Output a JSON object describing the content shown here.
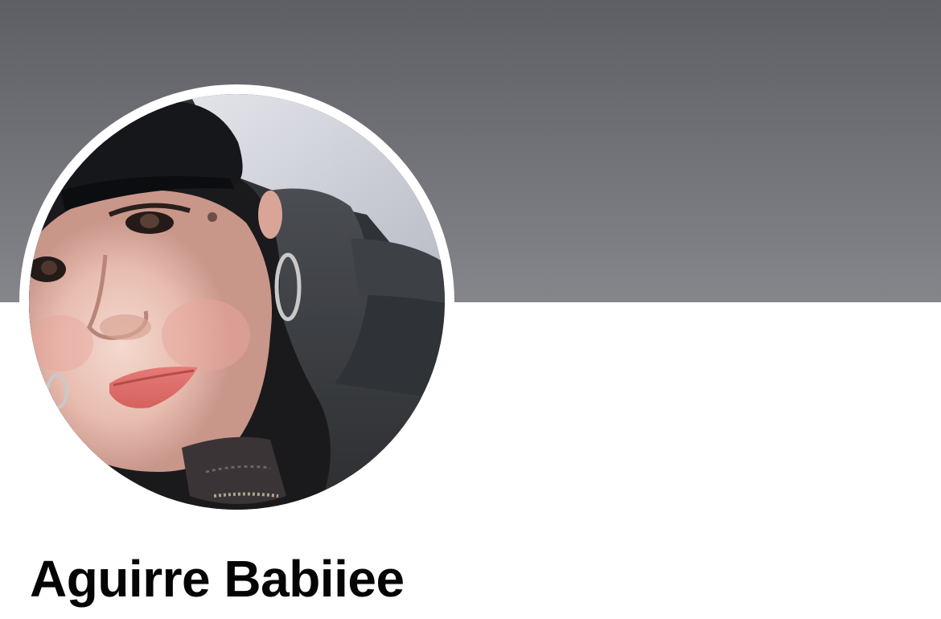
{
  "profile": {
    "name": "Aguirre Babiiee"
  },
  "icons": {
    "profile_photo": "person-selfie-photo"
  },
  "colors": {
    "cover_top": "#5e5f64",
    "cover_bottom": "#85868b",
    "ring": "#ffffff",
    "name_text": "#050505",
    "background": "#ffffff"
  }
}
